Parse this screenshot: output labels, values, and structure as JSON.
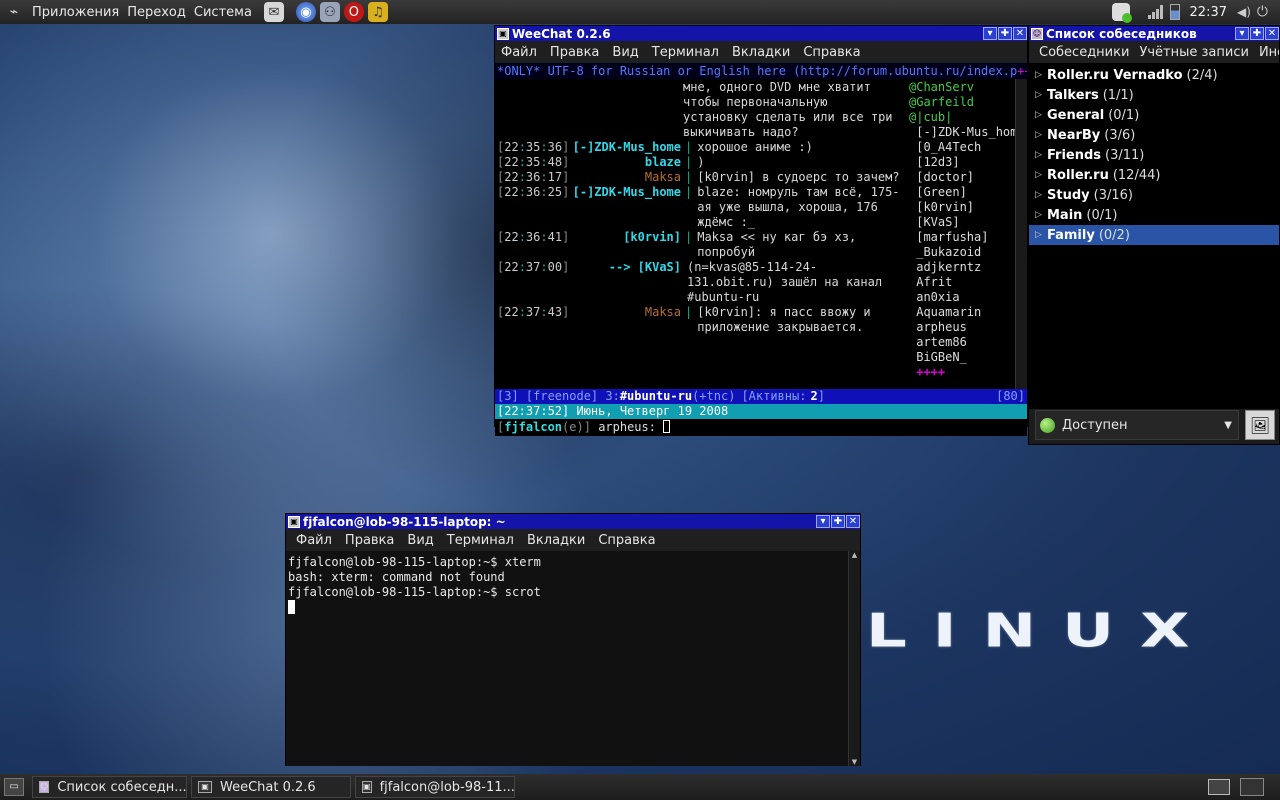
{
  "top_panel": {
    "menus": [
      "Приложения",
      "Переход",
      "Система"
    ],
    "launchers": [
      "mail-icon",
      "browser-icon",
      "network-icon",
      "opera-icon",
      "audio-icon"
    ],
    "clock": "22:37"
  },
  "weechat": {
    "title": "WeeChat 0.2.6",
    "menu": [
      "Файл",
      "Правка",
      "Вид",
      "Терминал",
      "Вкладки",
      "Справка"
    ],
    "topic": "*ONLY* UTF-8 for Russian or English here (http://forum.ubuntu.ru/index.p",
    "topic_more": "++",
    "lines": [
      {
        "time": "",
        "nick": "",
        "nick_color": "#ddd",
        "sep": "",
        "msg": "мне, одного DVD мне хватит чтобы первоначальную установку сделать или все три выкичивать надо?"
      },
      {
        "time": "22:35:36",
        "nick": "[-]ZDK-Mus_home",
        "nick_color": "#33d8e8",
        "sep": "|",
        "msg": "хорошое аниме :)"
      },
      {
        "time": "22:35:48",
        "nick": "blaze",
        "nick_color": "#33d8e8",
        "sep": "|",
        "msg": ")"
      },
      {
        "time": "22:36:17",
        "nick": "Maksa",
        "nick_color": "#b5702a",
        "sep": "|",
        "msg": "[k0rvin] в судоерс то зачем?"
      },
      {
        "time": "22:36:25",
        "nick": "[-]ZDK-Mus_home",
        "nick_color": "#33d8e8",
        "sep": "|",
        "msg": "blaze:  номруль там всё, 175-ая уже вышла, хороша, 176 ждёмс :_"
      },
      {
        "time": "22:36:41",
        "nick": "[k0rvin]",
        "nick_color": "#33d8e8",
        "sep": "|",
        "msg": "Maksa << ну каг бэ хз, попробуй"
      },
      {
        "time": "22:37:00",
        "nick": "--> [KVaS]",
        "nick_color": "#33d8e8",
        "sep": "",
        "msg": "(n=kvas@85-114-24-131.obit.ru) зашёл на канал #ubuntu-ru"
      },
      {
        "time": "22:37:43",
        "nick": "Maksa",
        "nick_color": "#b5702a",
        "sep": "|",
        "msg": "[k0rvin]: я пасс ввожу и приложение закрывается."
      }
    ],
    "nicklist": [
      "@ChanServ",
      "@Garfeild",
      "@|cub|",
      " [-]ZDK-Mus_home",
      " [0_A4Tech",
      " [12d3]",
      " [doctor]",
      " [Green]",
      " [k0rvin]",
      " [KVaS]",
      " [marfusha]",
      " _Bukazoid",
      " adjkerntz",
      " Afrit",
      " an0xia",
      " Aquamarin",
      " arpheus",
      " artem86",
      " BiGBeN_",
      " ++++"
    ],
    "status_left": "[3] [freenode] 3:",
    "status_channel": "#ubuntu-ru",
    "status_modes": "(+tnc)",
    "status_active_label": "[Активны:",
    "status_active_count": "2",
    "status_active_close": "]",
    "status_right": "[80]",
    "infobar": "[22:37:52] Июнь, Четверг 19 2008",
    "input_nick": "fjfalcon",
    "input_mode": "(e)",
    "input_text": "arpheus: "
  },
  "buddylist": {
    "title": "Список собеседников",
    "tabs": [
      "Собеседники",
      "Учётные записи",
      "Инс"
    ],
    "groups": [
      {
        "name": "Roller.ru Vernadko",
        "count": "(2/4)"
      },
      {
        "name": "Talkers",
        "count": "(1/1)"
      },
      {
        "name": "General",
        "count": "(0/1)"
      },
      {
        "name": "NearBy",
        "count": "(3/6)"
      },
      {
        "name": "Friends",
        "count": "(3/11)"
      },
      {
        "name": "Roller.ru",
        "count": "(12/44)"
      },
      {
        "name": "Study",
        "count": "(3/16)"
      },
      {
        "name": "Main",
        "count": "(0/1)"
      },
      {
        "name": "Family",
        "count": "(0/2)"
      }
    ],
    "status": "Доступен"
  },
  "terminal": {
    "title": "fjfalcon@lob-98-115-laptop: ~",
    "menu": [
      "Файл",
      "Правка",
      "Вид",
      "Терминал",
      "Вкладки",
      "Справка"
    ],
    "lines": [
      "fjfalcon@lob-98-115-laptop:~$ xterm",
      "bash: xterm: command not found",
      "fjfalcon@lob-98-115-laptop:~$ scrot"
    ]
  },
  "taskbar": {
    "tasks": [
      "Список собеседн...",
      "WeeChat 0.2.6",
      "fjfalcon@lob-98-11..."
    ]
  },
  "wallpaper": {
    "logo_text": "LINUX"
  }
}
